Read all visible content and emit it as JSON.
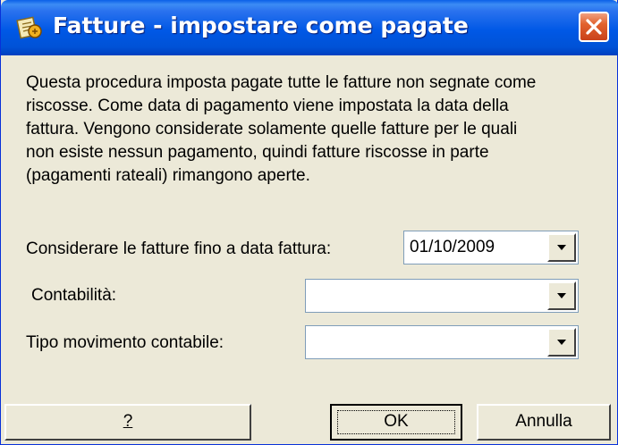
{
  "window": {
    "title": "Fatture - impostare come pagate",
    "close_icon": "close-icon"
  },
  "description": [
    "Questa procedura imposta pagate tutte le fatture non segnate come",
    "riscosse. Come data di pagamento viene impostata la data della",
    "fattura. Vengono considerate solamente quelle fatture per le quali",
    "non esiste nessun pagamento, quindi fatture riscosse in parte",
    "(pagamenti rateali) rimangono aperte."
  ],
  "form": {
    "date_label": "Considerare le fatture fino a data fattura:",
    "date_value": "01/10/2009",
    "accounting_label": "Contabilità:",
    "accounting_value": "",
    "movement_label": "Tipo movimento contabile:",
    "movement_value": ""
  },
  "buttons": {
    "help": "?",
    "ok": "OK",
    "cancel": "Annulla"
  },
  "colors": {
    "titlebar": "#0058e6",
    "dialog_bg": "#ece9d8",
    "close_button": "#e2622e"
  }
}
